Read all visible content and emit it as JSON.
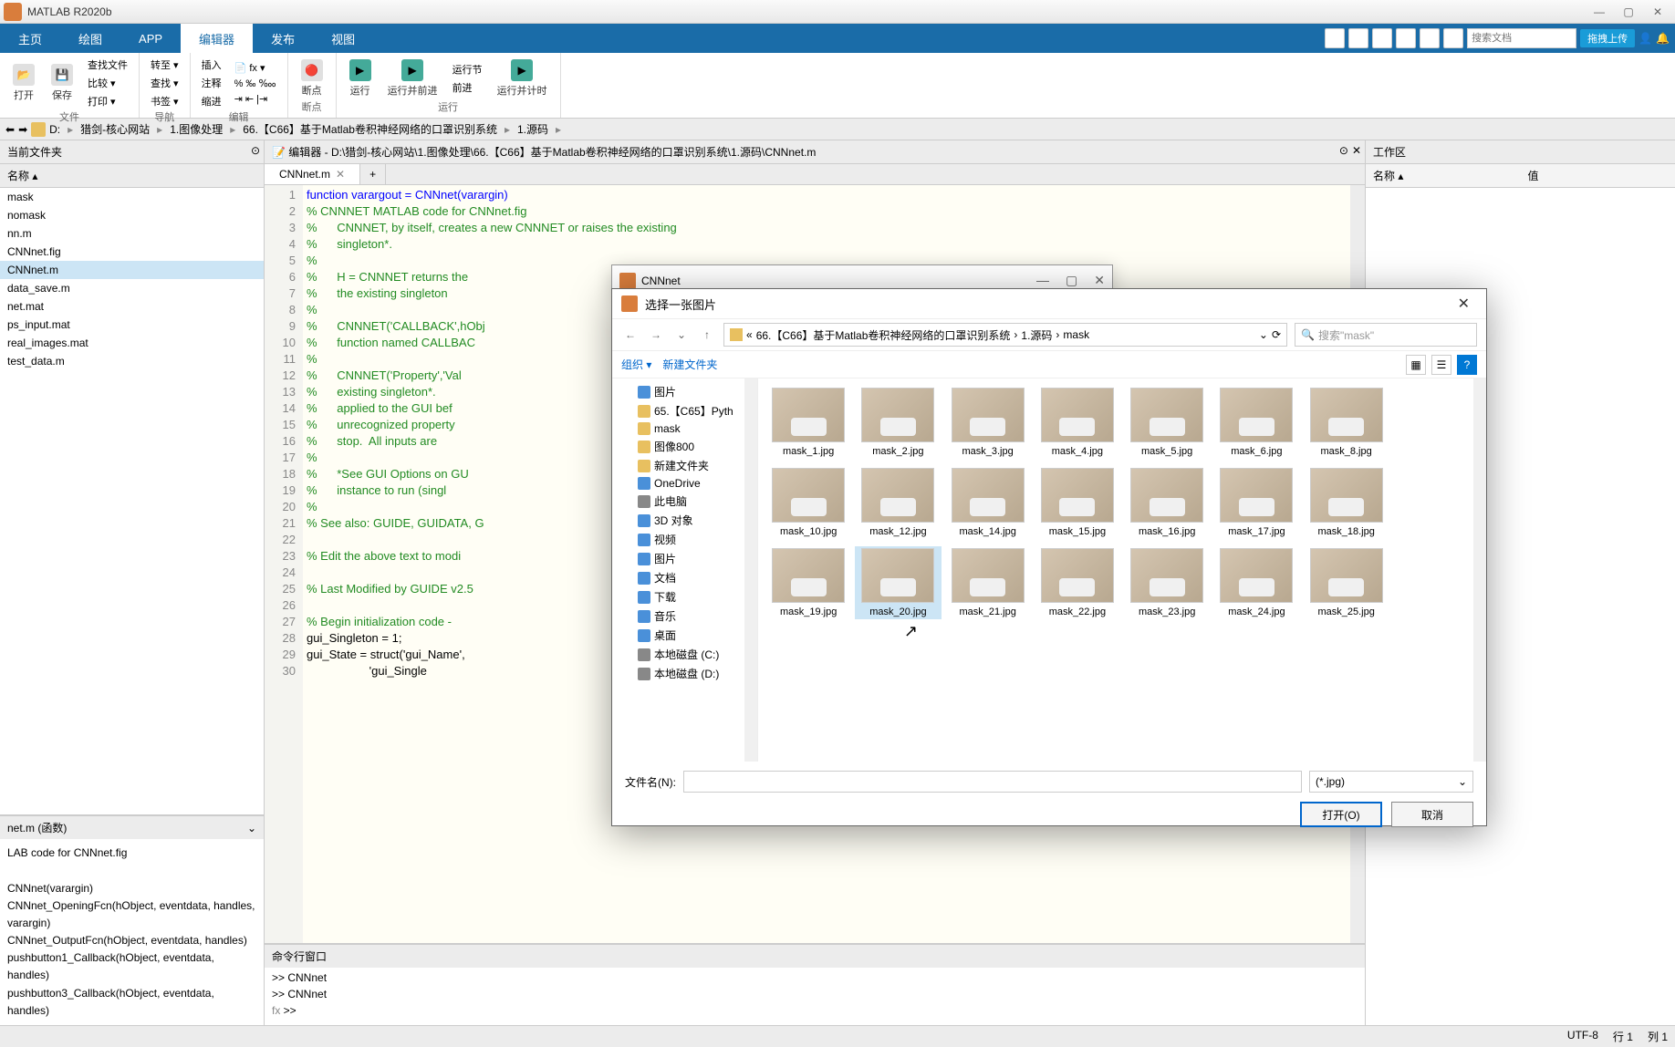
{
  "app": {
    "title": "MATLAB R2020b"
  },
  "tabs": [
    "主页",
    "绘图",
    "APP",
    "编辑器",
    "发布",
    "视图"
  ],
  "active_tab": "编辑器",
  "quick": {
    "search_ph": "搜索文档",
    "upload": "拖拽上传"
  },
  "ribbon": {
    "file": {
      "open": "打开",
      "save": "保存",
      "compare": "比较 ▾",
      "print": "打印 ▾",
      "label": "文件",
      "find": "查找文件"
    },
    "nav": {
      "insert": "插入",
      "comment": "注释",
      "indent": "缩进",
      "goto": "转至 ▾",
      "find_nav": "查找 ▾",
      "label": "导航",
      "bookmark": "书签 ▾"
    },
    "edit": {
      "label": "编辑"
    },
    "bp": {
      "bp": "断点",
      "label": "断点"
    },
    "run": {
      "run": "运行",
      "run_section": "运行节",
      "step": "运行并前进",
      "adv": "前进",
      "run_time": "运行并计时",
      "label": "运行"
    }
  },
  "breadcrumb": [
    "D:",
    "猎剑-核心网站",
    "1.图像处理",
    "66.【C66】基于Matlab卷积神经网络的口罩识别系统",
    "1.源码"
  ],
  "left": {
    "title": "当前文件夹",
    "name_col": "名称 ▴",
    "files": [
      "mask",
      "nomask",
      "nn.m",
      "CNNnet.fig",
      "CNNnet.m",
      "data_save.m",
      "net.mat",
      "ps_input.mat",
      "real_images.mat",
      "test_data.m"
    ],
    "selected": "CNNnet.m",
    "detail_title": "net.m (函数)",
    "details": [
      "LAB code for CNNnet.fig",
      "",
      "CNNnet(varargin)",
      "CNNnet_OpeningFcn(hObject, eventdata, handles, varargin)",
      "CNNnet_OutputFcn(hObject, eventdata, handles)",
      "pushbutton1_Callback(hObject, eventdata, handles)",
      "pushbutton3_Callback(hObject, eventdata, handles)"
    ]
  },
  "editor": {
    "title": "编辑器 - D:\\猎剑-核心网站\\1.图像处理\\66.【C66】基于Matlab卷积神经网络的口罩识别系统\\1.源码\\CNNnet.m",
    "tab": "CNNnet.m",
    "code": [
      {
        "n": "1",
        "t": "function varargout = CNNnet(varargin)",
        "cls": "kw"
      },
      {
        "n": "2",
        "t": "% CNNNET MATLAB code for CNNnet.fig",
        "cls": "cm"
      },
      {
        "n": "3",
        "t": "%      CNNNET, by itself, creates a new CNNNET or raises the existing",
        "cls": "cm"
      },
      {
        "n": "4",
        "t": "%      singleton*.",
        "cls": "cm"
      },
      {
        "n": "5",
        "t": "%",
        "cls": "cm"
      },
      {
        "n": "6",
        "t": "%      H = CNNNET returns the",
        "cls": "cm"
      },
      {
        "n": "7",
        "t": "%      the existing singleton",
        "cls": "cm"
      },
      {
        "n": "8",
        "t": "%",
        "cls": "cm"
      },
      {
        "n": "9",
        "t": "%      CNNNET('CALLBACK',hObj",
        "cls": "cm"
      },
      {
        "n": "10",
        "t": "%      function named CALLBAC",
        "cls": "cm"
      },
      {
        "n": "11",
        "t": "%",
        "cls": "cm"
      },
      {
        "n": "12",
        "t": "%      CNNNET('Property','Val",
        "cls": "cm"
      },
      {
        "n": "13",
        "t": "%      existing singleton*.  ",
        "cls": "cm"
      },
      {
        "n": "14",
        "t": "%      applied to the GUI bef",
        "cls": "cm"
      },
      {
        "n": "15",
        "t": "%      unrecognized property ",
        "cls": "cm"
      },
      {
        "n": "16",
        "t": "%      stop.  All inputs are ",
        "cls": "cm"
      },
      {
        "n": "17",
        "t": "%",
        "cls": "cm"
      },
      {
        "n": "18",
        "t": "%      *See GUI Options on GU",
        "cls": "cm"
      },
      {
        "n": "19",
        "t": "%      instance to run (singl",
        "cls": "cm"
      },
      {
        "n": "20",
        "t": "%",
        "cls": "cm"
      },
      {
        "n": "21",
        "t": "% See also: GUIDE, GUIDATA, G",
        "cls": "cm"
      },
      {
        "n": "22",
        "t": "",
        "cls": ""
      },
      {
        "n": "23",
        "t": "% Edit the above text to modi",
        "cls": "cm"
      },
      {
        "n": "24",
        "t": "",
        "cls": ""
      },
      {
        "n": "25",
        "t": "% Last Modified by GUIDE v2.5",
        "cls": "cm"
      },
      {
        "n": "26",
        "t": "",
        "cls": ""
      },
      {
        "n": "27",
        "t": "% Begin initialization code -",
        "cls": "cm"
      },
      {
        "n": "28",
        "t": "gui_Singleton = 1;",
        "cls": "fn"
      },
      {
        "n": "29",
        "t": "gui_State = struct('gui_Name',",
        "cls": "fn"
      },
      {
        "n": "30",
        "t": "                   'gui_Single",
        "cls": "fn"
      }
    ]
  },
  "command": {
    "title": "命令行窗口",
    "lines": [
      ">> CNNnet",
      ">> CNNnet"
    ],
    "prompt": "fx >>"
  },
  "workspace": {
    "title": "工作区",
    "col1": "名称 ▴",
    "col2": "值"
  },
  "cnn_win": {
    "title": "CNNnet"
  },
  "dialog": {
    "title": "选择一张图片",
    "path": [
      "66.【C66】基于Matlab卷积神经网络的口罩识别系统",
      "1.源码",
      "mask"
    ],
    "search_ph": "搜索\"mask\"",
    "org": "组织 ▾",
    "newf": "新建文件夹",
    "tree": [
      {
        "t": "图片",
        "i": "blue"
      },
      {
        "t": "65.【C65】Pyth",
        "i": ""
      },
      {
        "t": "mask",
        "i": ""
      },
      {
        "t": "图像800",
        "i": ""
      },
      {
        "t": "新建文件夹",
        "i": ""
      },
      {
        "t": "OneDrive",
        "i": "blue"
      },
      {
        "t": "此电脑",
        "i": "gray"
      },
      {
        "t": "3D 对象",
        "i": "blue"
      },
      {
        "t": "视频",
        "i": "blue"
      },
      {
        "t": "图片",
        "i": "blue"
      },
      {
        "t": "文档",
        "i": "blue"
      },
      {
        "t": "下载",
        "i": "blue"
      },
      {
        "t": "音乐",
        "i": "blue"
      },
      {
        "t": "桌面",
        "i": "blue"
      },
      {
        "t": "本地磁盘 (C:)",
        "i": "gray"
      },
      {
        "t": "本地磁盘 (D:)",
        "i": "gray"
      }
    ],
    "files": [
      "mask_1.jpg",
      "mask_2.jpg",
      "mask_3.jpg",
      "mask_4.jpg",
      "mask_5.jpg",
      "mask_6.jpg",
      "mask_8.jpg",
      "",
      "mask_10.jpg",
      "mask_12.jpg",
      "mask_14.jpg",
      "mask_15.jpg",
      "mask_16.jpg",
      "mask_17.jpg",
      "mask_18.jpg",
      "",
      "mask_19.jpg",
      "mask_20.jpg",
      "mask_21.jpg",
      "mask_22.jpg",
      "mask_23.jpg",
      "mask_24.jpg",
      "mask_25.jpg",
      ""
    ],
    "hover_idx": 17,
    "fname_lbl": "文件名(N):",
    "filter": "(*.jpg)",
    "open": "打开(O)",
    "cancel": "取消"
  },
  "status": {
    "enc": "UTF-8",
    "line": "行",
    "lineval": "1",
    "col": "列",
    "colval": "1"
  }
}
